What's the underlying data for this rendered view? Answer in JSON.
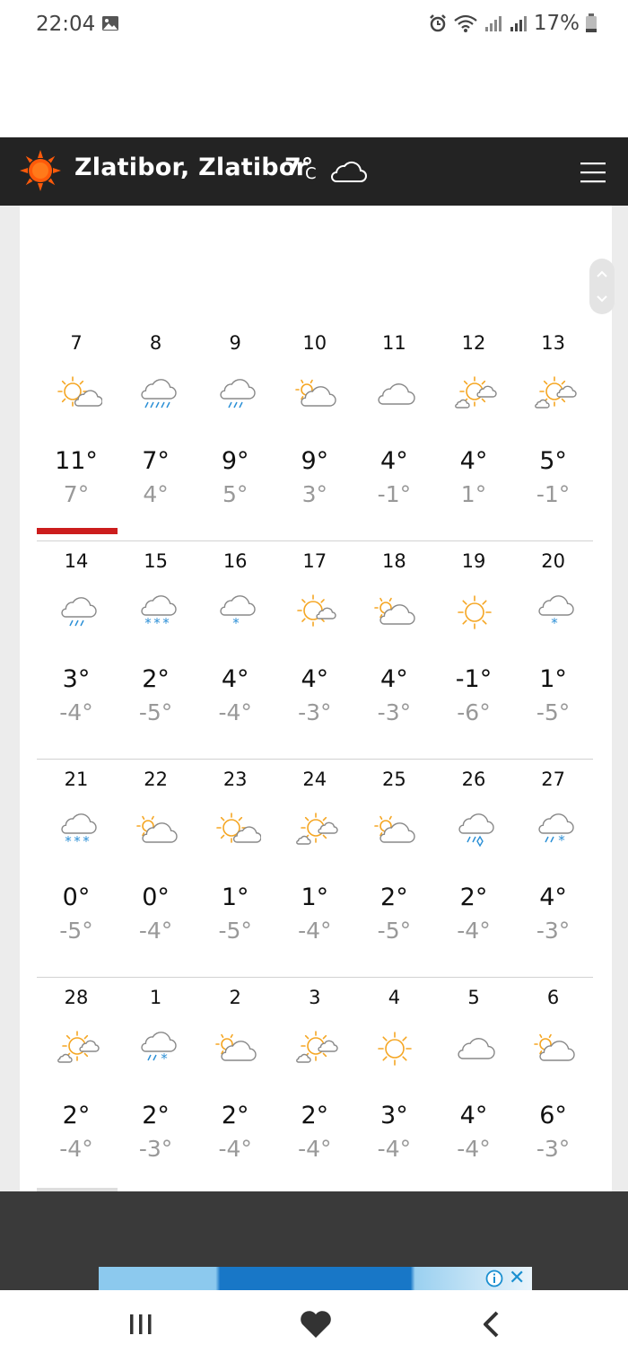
{
  "status_bar": {
    "time": "22:04",
    "battery": "17%"
  },
  "header": {
    "location": "Zlatibor, Zlatibor",
    "temperature": "7°",
    "unit": "C",
    "condition_icon": "cloud-icon",
    "menu_icon": "hamburger-menu-icon"
  },
  "forecast": {
    "selected_index": 0,
    "weeks": [
      [
        {
          "day": "7",
          "hi": "11°",
          "lo": "7°",
          "icon": "sun-cloud"
        },
        {
          "day": "8",
          "hi": "7°",
          "lo": "4°",
          "icon": "cloud-rain"
        },
        {
          "day": "9",
          "hi": "9°",
          "lo": "5°",
          "icon": "cloud-light-rain"
        },
        {
          "day": "10",
          "hi": "9°",
          "lo": "3°",
          "icon": "partly-cloudy"
        },
        {
          "day": "11",
          "hi": "4°",
          "lo": "-1°",
          "icon": "cloud"
        },
        {
          "day": "12",
          "hi": "4°",
          "lo": "1°",
          "icon": "sun-two-clouds"
        },
        {
          "day": "13",
          "hi": "5°",
          "lo": "-1°",
          "icon": "sun-two-clouds"
        }
      ],
      [
        {
          "day": "14",
          "hi": "3°",
          "lo": "-4°",
          "icon": "cloud-light-rain"
        },
        {
          "day": "15",
          "hi": "2°",
          "lo": "-5°",
          "icon": "cloud-snow"
        },
        {
          "day": "16",
          "hi": "4°",
          "lo": "-4°",
          "icon": "cloud-light-snow"
        },
        {
          "day": "17",
          "hi": "4°",
          "lo": "-3°",
          "icon": "sun-small-cloud"
        },
        {
          "day": "18",
          "hi": "4°",
          "lo": "-3°",
          "icon": "partly-cloudy"
        },
        {
          "day": "19",
          "hi": "-1°",
          "lo": "-6°",
          "icon": "sun"
        },
        {
          "day": "20",
          "hi": "1°",
          "lo": "-5°",
          "icon": "cloud-light-snow"
        }
      ],
      [
        {
          "day": "21",
          "hi": "0°",
          "lo": "-5°",
          "icon": "cloud-snow"
        },
        {
          "day": "22",
          "hi": "0°",
          "lo": "-4°",
          "icon": "partly-cloudy"
        },
        {
          "day": "23",
          "hi": "1°",
          "lo": "-5°",
          "icon": "sun-cloud"
        },
        {
          "day": "24",
          "hi": "1°",
          "lo": "-4°",
          "icon": "sun-two-clouds"
        },
        {
          "day": "25",
          "hi": "2°",
          "lo": "-5°",
          "icon": "partly-cloudy"
        },
        {
          "day": "26",
          "hi": "2°",
          "lo": "-4°",
          "icon": "cloud-sleet"
        },
        {
          "day": "27",
          "hi": "4°",
          "lo": "-3°",
          "icon": "cloud-rain-snow"
        }
      ],
      [
        {
          "day": "28",
          "hi": "2°",
          "lo": "-4°",
          "icon": "sun-two-clouds"
        },
        {
          "day": "1",
          "hi": "2°",
          "lo": "-3°",
          "icon": "cloud-rain-snow"
        },
        {
          "day": "2",
          "hi": "2°",
          "lo": "-4°",
          "icon": "partly-cloudy"
        },
        {
          "day": "3",
          "hi": "2°",
          "lo": "-4°",
          "icon": "sun-two-clouds"
        },
        {
          "day": "4",
          "hi": "3°",
          "lo": "-4°",
          "icon": "sun"
        },
        {
          "day": "5",
          "hi": "4°",
          "lo": "-4°",
          "icon": "cloud"
        },
        {
          "day": "6",
          "hi": "6°",
          "lo": "-3°",
          "icon": "partly-cloudy"
        }
      ]
    ]
  },
  "nav": {
    "recents_icon": "recents-icon",
    "home_icon": "heart-icon",
    "back_icon": "back-chevron-icon"
  },
  "colors": {
    "header_bg": "#232323",
    "sun": "#f5a623",
    "precip": "#2b8fd6",
    "active": "#cc1d1d"
  }
}
